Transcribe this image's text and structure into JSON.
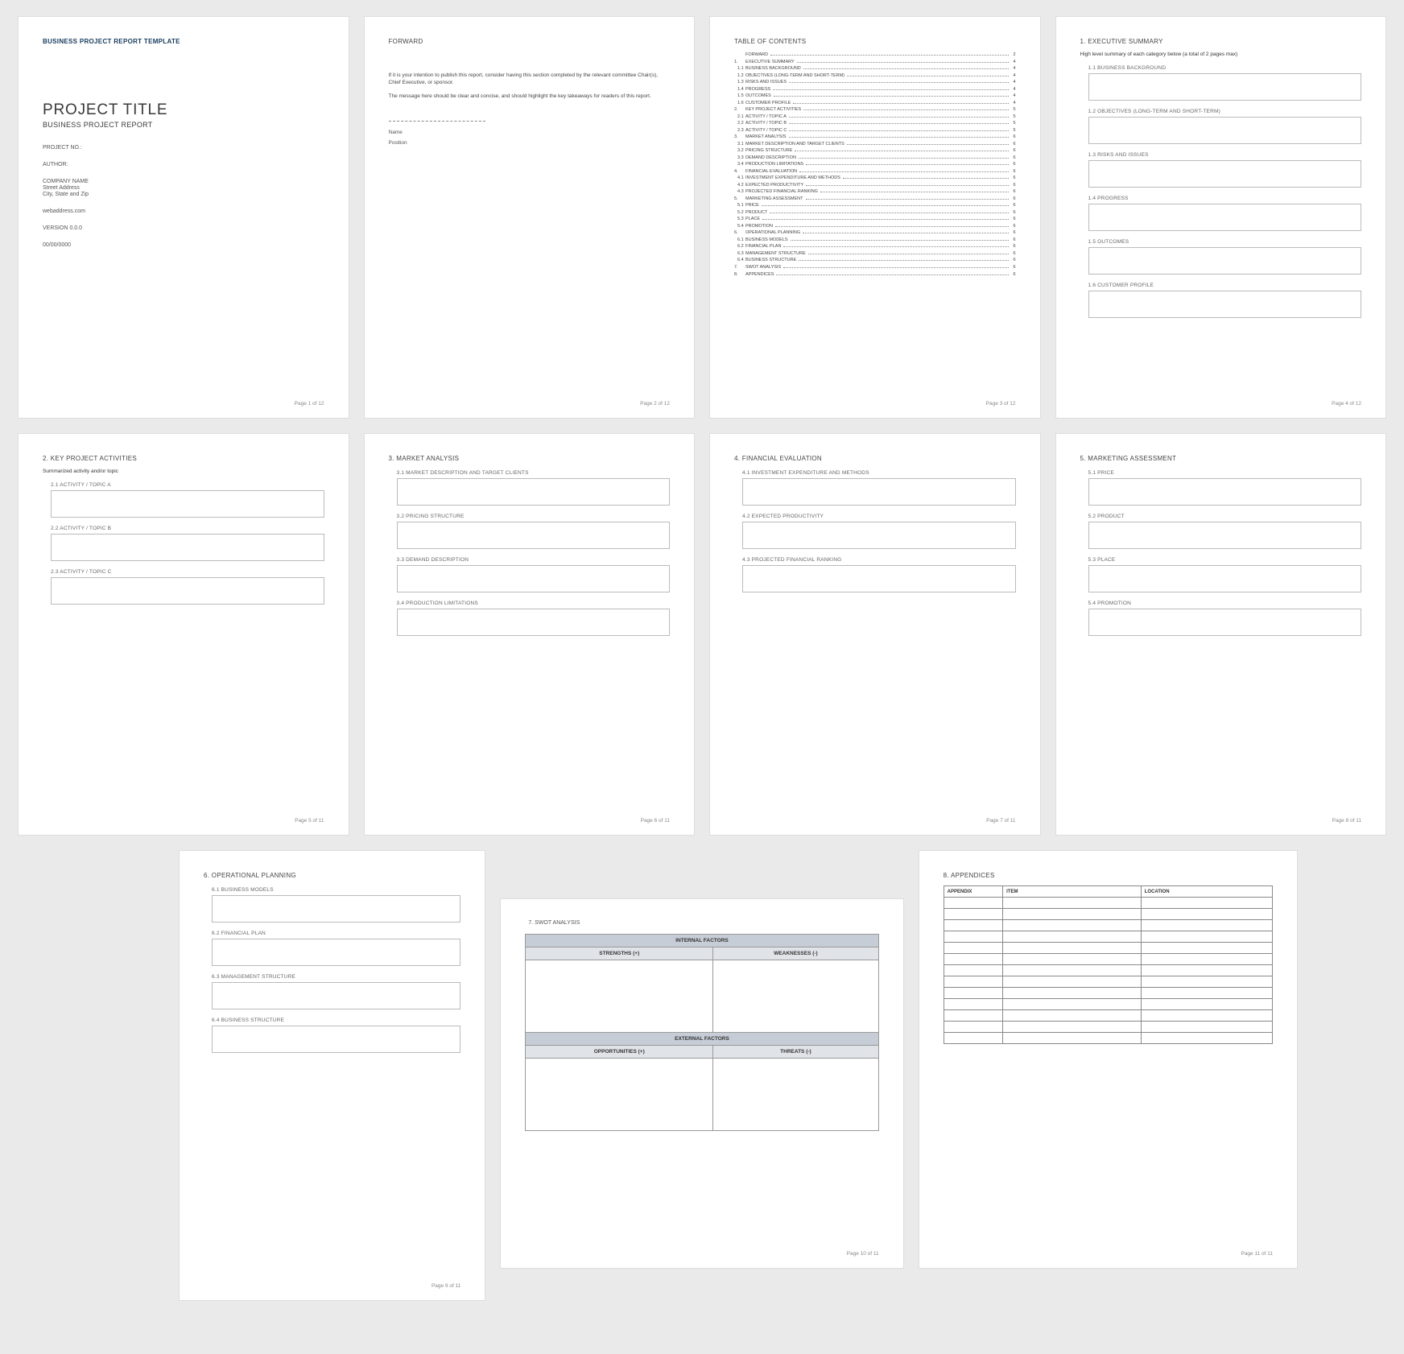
{
  "p1": {
    "template": "BUSINESS PROJECT REPORT TEMPLATE",
    "title": "PROJECT TITLE",
    "subtitle": "BUSINESS PROJECT REPORT",
    "project_no": "PROJECT NO.:",
    "author": "AUTHOR:",
    "company": "COMPANY NAME",
    "street": "Street Address",
    "city": "City, State and Zip",
    "web": "webaddress.com",
    "version": "VERSION 0.0.0",
    "date": "00/00/0000",
    "footer": "Page 1 of 12"
  },
  "p2": {
    "heading": "FORWARD",
    "body1": "If it is your intention to publish this report, consider having this section completed by the relevant committee Chair(s), Chief Executive, or sponsor.",
    "body2": "The message here should be clear and concise, and should highlight the key takeaways for readers of this report.",
    "name": "Name",
    "position": "Position",
    "footer": "Page 2 of 12"
  },
  "p3": {
    "heading": "TABLE OF CONTENTS",
    "items": [
      {
        "n": "",
        "l": "FORWARD",
        "p": "2"
      },
      {
        "n": "1.",
        "l": "EXECUTIVE SUMMARY",
        "p": "4"
      },
      {
        "n": "1.1",
        "l": "BUSINESS BACKGROUND",
        "p": "4",
        "s": 1
      },
      {
        "n": "1.2",
        "l": "OBJECTIVES (LONG-TERM AND SHORT-TERM)",
        "p": "4",
        "s": 1
      },
      {
        "n": "1.3",
        "l": "RISKS AND ISSUES",
        "p": "4",
        "s": 1
      },
      {
        "n": "1.4",
        "l": "PROGRESS",
        "p": "4",
        "s": 1
      },
      {
        "n": "1.5",
        "l": "OUTCOMES",
        "p": "4",
        "s": 1
      },
      {
        "n": "1.6",
        "l": "CUSTOMER PROFILE",
        "p": "4",
        "s": 1
      },
      {
        "n": "2.",
        "l": "KEY PROJECT ACTIVITIES",
        "p": "5"
      },
      {
        "n": "2.1",
        "l": "ACTIVITY / TOPIC A",
        "p": "5",
        "s": 1
      },
      {
        "n": "2.2",
        "l": "ACTIVITY / TOPIC B",
        "p": "5",
        "s": 1
      },
      {
        "n": "2.3",
        "l": "ACTIVITY / TOPIC C",
        "p": "5",
        "s": 1
      },
      {
        "n": "3.",
        "l": "MARKET ANALYSIS",
        "p": "6"
      },
      {
        "n": "3.1",
        "l": "MARKET DESCRIPTION AND TARGET CLIENTS",
        "p": "6",
        "s": 1
      },
      {
        "n": "3.2",
        "l": "PRICING STRUCTURE",
        "p": "6",
        "s": 1
      },
      {
        "n": "3.3",
        "l": "DEMAND DESCRIPTION",
        "p": "6",
        "s": 1
      },
      {
        "n": "3.4",
        "l": "PRODUCTION LIMITATIONS",
        "p": "6",
        "s": 1
      },
      {
        "n": "4.",
        "l": "FINANCIAL EVALUATION",
        "p": "6"
      },
      {
        "n": "4.1",
        "l": "INVESTMENT EXPENDITURE AND METHODS",
        "p": "6",
        "s": 1
      },
      {
        "n": "4.2",
        "l": "EXPECTED PRODUCTIVITY",
        "p": "6",
        "s": 1
      },
      {
        "n": "4.3",
        "l": "PROJECTED FINANCIAL RANKING",
        "p": "6",
        "s": 1
      },
      {
        "n": "5.",
        "l": "MARKETING ASSESSMENT",
        "p": "6"
      },
      {
        "n": "5.1",
        "l": "PRICE",
        "p": "6",
        "s": 1
      },
      {
        "n": "5.2",
        "l": "PRODUCT",
        "p": "6",
        "s": 1
      },
      {
        "n": "5.3",
        "l": "PLACE",
        "p": "6",
        "s": 1
      },
      {
        "n": "5.4",
        "l": "PROMOTION",
        "p": "6",
        "s": 1
      },
      {
        "n": "6.",
        "l": "OPERATIONAL PLANNING",
        "p": "6"
      },
      {
        "n": "6.1",
        "l": "BUSINESS MODELS",
        "p": "6",
        "s": 1
      },
      {
        "n": "6.2",
        "l": "FINANCIAL PLAN",
        "p": "6",
        "s": 1
      },
      {
        "n": "6.3",
        "l": "MANAGEMENT STRUCTURE",
        "p": "6",
        "s": 1
      },
      {
        "n": "6.4",
        "l": "BUSINESS STRUCTURE",
        "p": "6",
        "s": 1
      },
      {
        "n": "7.",
        "l": "SWOT ANALYSIS",
        "p": "6"
      },
      {
        "n": "8.",
        "l": "APPENDICES",
        "p": "6"
      }
    ],
    "footer": "Page 3 of 12"
  },
  "p4": {
    "heading": "1. EXECUTIVE SUMMARY",
    "note": "High level summary of each category below (a total of 2 pages max)",
    "subs": [
      "1.1   BUSINESS BACKGROUND",
      "1.2   OBJECTIVES (LONG-TERM AND SHORT-TERM)",
      "1.3   RISKS AND ISSUES",
      "1.4   PROGRESS",
      "1.5   OUTCOMES",
      "1.6   CUSTOMER PROFILE"
    ],
    "footer": "Page 4 of 12"
  },
  "p5": {
    "heading": "2. KEY PROJECT ACTIVITIES",
    "note": "Summarized activity and/or topic",
    "subs": [
      "2.1   ACTIVITY / TOPIC A",
      "2.2   ACTIVITY / TOPIC B",
      "2.3   ACTIVITY / TOPIC C"
    ],
    "footer": "Page 5 of 11"
  },
  "p6": {
    "heading": "3. MARKET ANALYSIS",
    "subs": [
      "3.1   MARKET DESCRIPTION AND TARGET CLIENTS",
      "3.2   PRICING STRUCTURE",
      "3.3   DEMAND DESCRIPTION",
      "3.4   PRODUCTION LIMITATIONS"
    ],
    "footer": "Page 6 of 11"
  },
  "p7": {
    "heading": "4. FINANCIAL EVALUATION",
    "subs": [
      "4.1   INVESTMENT EXPENDITURE AND METHODS",
      "4.2   EXPECTED PRODUCTIVITY",
      "4.3   PROJECTED FINANCIAL RANKING"
    ],
    "footer": "Page 7 of 11"
  },
  "p8": {
    "heading": "5. MARKETING ASSESSMENT",
    "subs": [
      "5.1   PRICE",
      "5.2   PRODUCT",
      "5.3   PLACE",
      "5.4   PROMOTION"
    ],
    "footer": "Page 8 of 11"
  },
  "p9": {
    "heading": "6. OPERATIONAL PLANNING",
    "subs": [
      "6.1   BUSINESS MODELS",
      "6.2   FINANCIAL PLAN",
      "6.3   MANAGEMENT STRUCTURE",
      "6.4   BUSINESS STRUCTURE"
    ],
    "footer": "Page 9 of 11"
  },
  "p10": {
    "heading": "7. SWOT ANALYSIS",
    "internal": "INTERNAL FACTORS",
    "external": "EXTERNAL FACTORS",
    "strengths": "STRENGTHS (+)",
    "weaknesses": "WEAKNESSES (-)",
    "opportunities": "OPPORTUNITIES (+)",
    "threats": "THREATS (-)",
    "footer": "Page 10 of 11"
  },
  "p11": {
    "heading": "8.  APPENDICES",
    "cols": [
      "APPENDIX",
      "ITEM",
      "LOCATION"
    ],
    "rows": 13,
    "footer": "Page 11 of 11"
  }
}
